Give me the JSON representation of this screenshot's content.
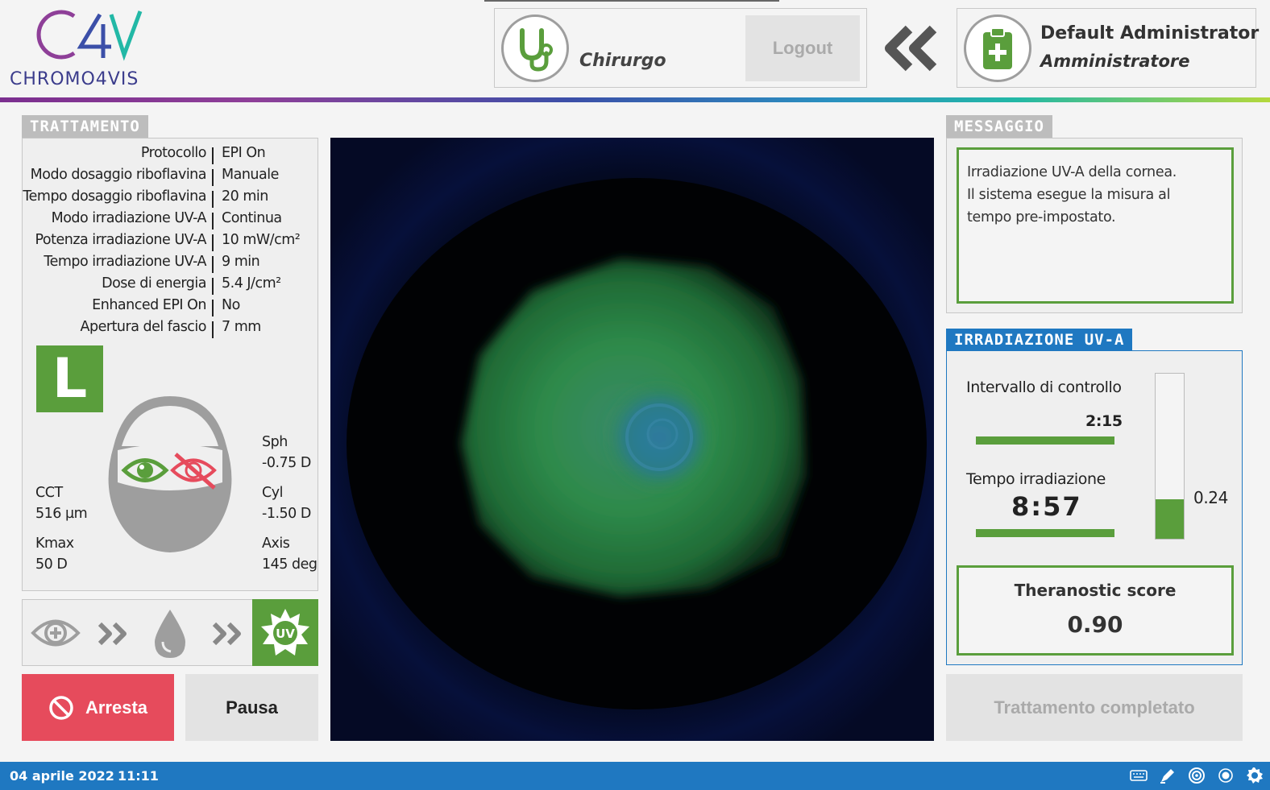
{
  "brand": {
    "logo_mark": "C4V",
    "logo_text": "CHROMO4VIS"
  },
  "header": {
    "surgeon_role": "Chirurgo",
    "logout_label": "Logout",
    "admin_name": "Default Administrator",
    "admin_role": "Amministratore"
  },
  "treatment": {
    "tab": "TRATTAMENTO",
    "rows": [
      {
        "label": "Protocollo",
        "value": "EPI On"
      },
      {
        "label": "Modo dosaggio riboflavina",
        "value": "Manuale"
      },
      {
        "label": "Tempo dosaggio riboflavina",
        "value": "20 min"
      },
      {
        "label": "Modo irradiazione UV-A",
        "value": "Continua"
      },
      {
        "label": "Potenza irradiazione UV-A",
        "value": "10 mW/cm²"
      },
      {
        "label": "Tempo irradiazione UV-A",
        "value": "9 min"
      },
      {
        "label": "Dose di energia",
        "value": "5.4 J/cm²"
      },
      {
        "label": "Enhanced EPI On",
        "value": "No"
      },
      {
        "label": "Apertura del fascio",
        "value": "7 mm"
      }
    ],
    "eye_side": "L",
    "cct_label": "CCT",
    "cct_value": "516 µm",
    "kmax_label": "Kmax",
    "kmax_value": "50 D",
    "sph_label": "Sph",
    "sph_value": "-0.75 D",
    "cyl_label": "Cyl",
    "cyl_value": "-1.50 D",
    "axis_label": "Axis",
    "axis_value": "145 deg",
    "step_uv_label": "UV"
  },
  "actions": {
    "stop_label": "Arresta",
    "pause_label": "Pausa",
    "done_label": "Trattamento completato"
  },
  "message": {
    "tab": "MESSAGGIO",
    "line1": "Irradiazione UV-A della cornea.",
    "line2": "Il sistema esegue la misura al",
    "line3": "tempo pre-impostato."
  },
  "irradiation": {
    "tab": "IRRADIAZIONE UV-A",
    "interval_label": "Intervallo di controllo",
    "interval_value": "2:15",
    "interval_progress": 1.0,
    "time_label": "Tempo irradiazione",
    "time_value": "8:57",
    "time_progress": 1.0,
    "vbar_value": "0.24",
    "vbar_fraction": 0.24,
    "score_label": "Theranostic score",
    "score_value": "0.90"
  },
  "status": {
    "date": "04 aprile 2022",
    "time": "11:11"
  },
  "colors": {
    "accent_green": "#5a9e3c",
    "accent_blue": "#1f78c1",
    "stop_red": "#e64b5c"
  }
}
